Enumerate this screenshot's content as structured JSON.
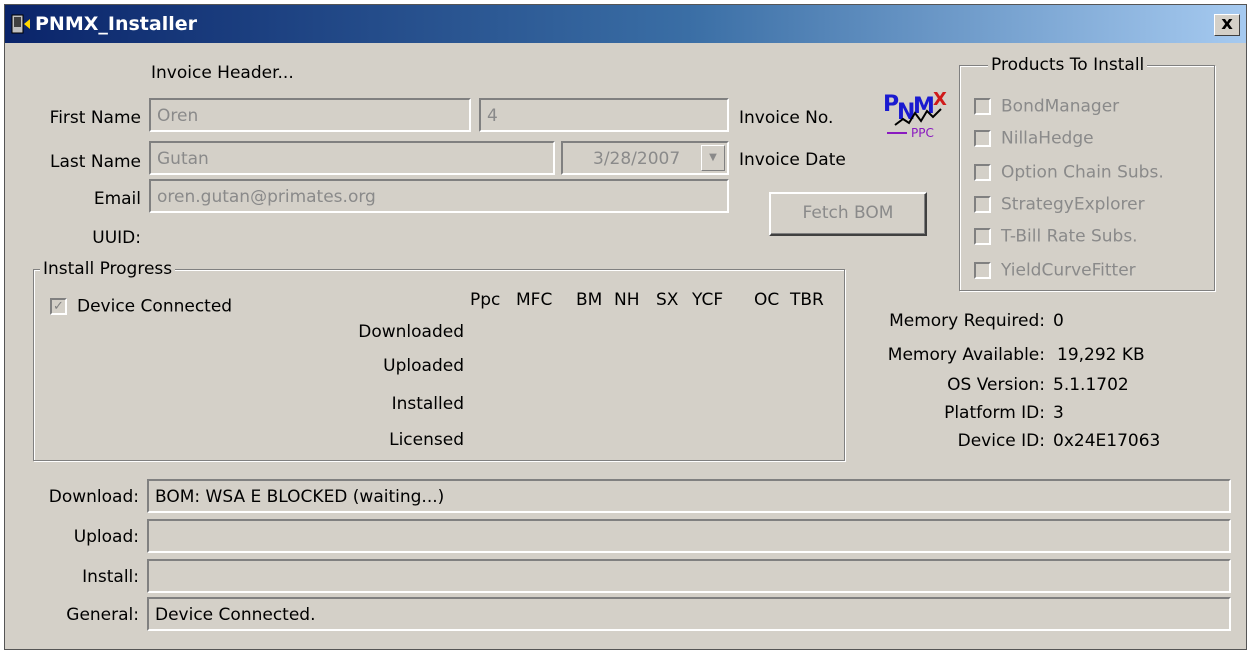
{
  "window": {
    "title": "PNMX_Installer",
    "close_label": "x",
    "icon": "app-window-icon"
  },
  "invoice": {
    "header_label": "Invoice Header...",
    "first_name_label": "First Name",
    "first_name_value": "Oren",
    "invoice_no_value": "4",
    "invoice_no_label": "Invoice No.",
    "last_name_label": "Last Name",
    "last_name_value": "Gutan",
    "invoice_date_value": "3/28/2007",
    "invoice_date_label": "Invoice Date",
    "email_label": "Email",
    "email_value": "oren.gutan@primates.org",
    "uuid_label": "UUID:"
  },
  "logo": {
    "text_top": "PNMX",
    "text_bottom": "PPC"
  },
  "fetch_button_label": "Fetch BOM",
  "products": {
    "title": "Products To Install",
    "items": [
      {
        "label": "BondManager",
        "checked": false
      },
      {
        "label": "NillaHedge",
        "checked": false
      },
      {
        "label": "Option Chain Subs.",
        "checked": false
      },
      {
        "label": "StrategyExplorer",
        "checked": false
      },
      {
        "label": "T-Bill Rate Subs.",
        "checked": false
      },
      {
        "label": "YieldCurveFitter",
        "checked": false
      }
    ]
  },
  "install_progress": {
    "title": "Install Progress",
    "device_connected_label": "Device Connected",
    "device_connected_checked": true,
    "columns": [
      "Ppc",
      "MFC",
      "BM",
      "NH",
      "SX",
      "YCF",
      "OC",
      "TBR"
    ],
    "rows": [
      "Downloaded",
      "Uploaded",
      "Installed",
      "Licensed"
    ]
  },
  "device_info": {
    "memory_required_label": "Memory Required:",
    "memory_required_value": "0",
    "memory_available_label": "Memory Available:",
    "memory_available_value": "19,292 KB",
    "os_version_label": "OS Version:",
    "os_version_value": "5.1.1702",
    "platform_id_label": "Platform ID:",
    "platform_id_value": "3",
    "device_id_label": "Device ID:",
    "device_id_value": "0x24E17063"
  },
  "status": {
    "download_label": "Download:",
    "download_value": "BOM: WSA E BLOCKED (waiting...)",
    "upload_label": "Upload:",
    "upload_value": "",
    "install_label": "Install:",
    "install_value": "",
    "general_label": "General:",
    "general_value": "Device Connected."
  }
}
